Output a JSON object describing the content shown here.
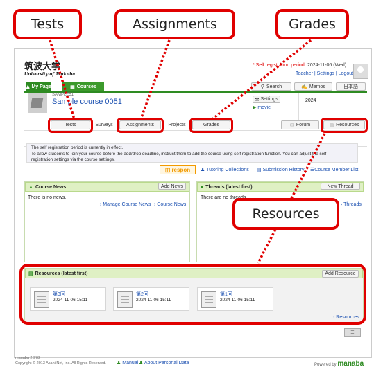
{
  "callouts": {
    "tests": "Tests",
    "assignments": "Assignments",
    "grades": "Grades",
    "resources": "Resources"
  },
  "header": {
    "logo_jp": "筑波大学",
    "logo_en": "University of Tsukuba",
    "notice": "* Self registration period",
    "date": "2024-11-06 (Wed)",
    "links": [
      "Teacher",
      "Settings",
      "Logout"
    ]
  },
  "nav": {
    "my_page": "My Page",
    "courses": "Courses",
    "search": "Search",
    "memos": "Memos",
    "lang": "日本語"
  },
  "course": {
    "code": "SAMPLE51",
    "title": "Sample course 0051",
    "settings": "Settings",
    "movie": "movie",
    "year": "2024"
  },
  "tabs": [
    "Tests",
    "Surveys",
    "Assignments",
    "Projects",
    "Grades",
    "Forum",
    "Resources"
  ],
  "notice_box": {
    "line1": "The self registration period is currently in effect.",
    "line2": "To allow students to join your course before the add/drop deadline, instruct them to add the course using self registration function. You can adjust the self",
    "line3": "registration settings via the course settings."
  },
  "links_row": {
    "respon": "respon",
    "tutoring": "Tutoring Collections",
    "submission": "Submission History",
    "members": "Course Member List"
  },
  "course_news": {
    "title": "Course News",
    "add": "Add News",
    "empty": "There is no news.",
    "manage": "Manage Course News",
    "news": "Course News"
  },
  "threads": {
    "title": "Threads (latest first)",
    "new": "New Thread",
    "empty": "There are no threads.",
    "link": "Threads"
  },
  "resources": {
    "title": "Resources (latest first)",
    "add": "Add Resource",
    "items": [
      {
        "name": "第3回",
        "date": "2024-11-06 15:11"
      },
      {
        "name": "第2回",
        "date": "2024-11-06 15:11"
      },
      {
        "name": "第1回",
        "date": "2024-11-06 15:11"
      }
    ],
    "link": "Resources"
  },
  "footer": {
    "version": "manaba 2.978",
    "copyright": "Copyright © 2013 Asahi Net, Inc. All Rights Reserved.",
    "manual": "Manual",
    "personal": "About Personal Data",
    "powered": "Powered by",
    "brand": "manaba"
  }
}
